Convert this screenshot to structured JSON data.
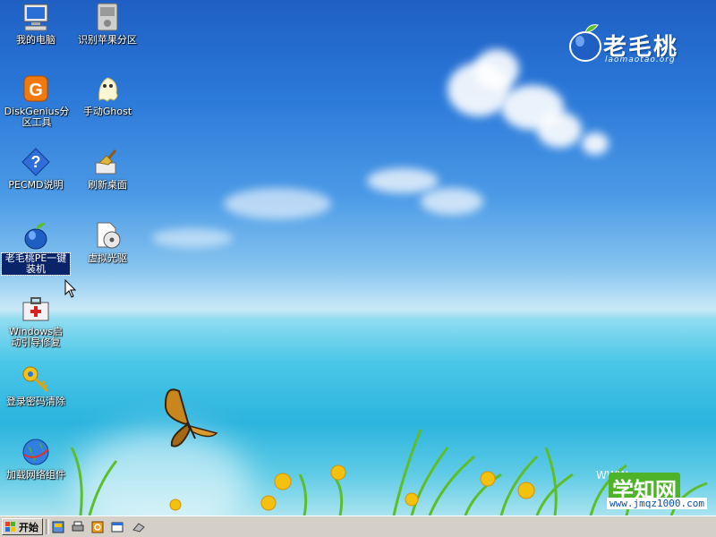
{
  "desktop_icons": [
    {
      "label": "我的电脑",
      "icon": "computer-icon"
    },
    {
      "label": "识别苹果分区",
      "icon": "disk-drive-icon"
    },
    {
      "label": "DiskGenius分区工具",
      "icon": "diskgenius-icon"
    },
    {
      "label": "手动Ghost",
      "icon": "ghost-icon"
    },
    {
      "label": "PECMD说明",
      "icon": "help-icon"
    },
    {
      "label": "刷新桌面",
      "icon": "broom-icon"
    },
    {
      "label": "老毛桃PE一键装机",
      "icon": "peach-icon",
      "selected": true
    },
    {
      "label": "虚拟光驱",
      "icon": "virtual-drive-icon"
    },
    {
      "label": "Windows启动引导修复",
      "icon": "repair-kit-icon"
    },
    {
      "label": "登录密码清除",
      "icon": "key-icon"
    },
    {
      "label": "加载网络组件",
      "icon": "network-globe-icon"
    }
  ],
  "logo": {
    "brand": "老毛桃",
    "url": "laomaotao.org"
  },
  "watermark": {
    "main": "学知网",
    "url": "www.jmqz1000.com",
    "prefix": "WWW"
  },
  "taskbar": {
    "start_label": "开始",
    "quick_launch": [
      "quick-launch-app-icon",
      "quick-launch-printer-icon",
      "quick-launch-search-icon",
      "quick-launch-window-icon",
      "quick-launch-eraser-icon"
    ]
  },
  "colors": {
    "selection": "#0a246a",
    "taskbar": "#d4d0c8"
  }
}
